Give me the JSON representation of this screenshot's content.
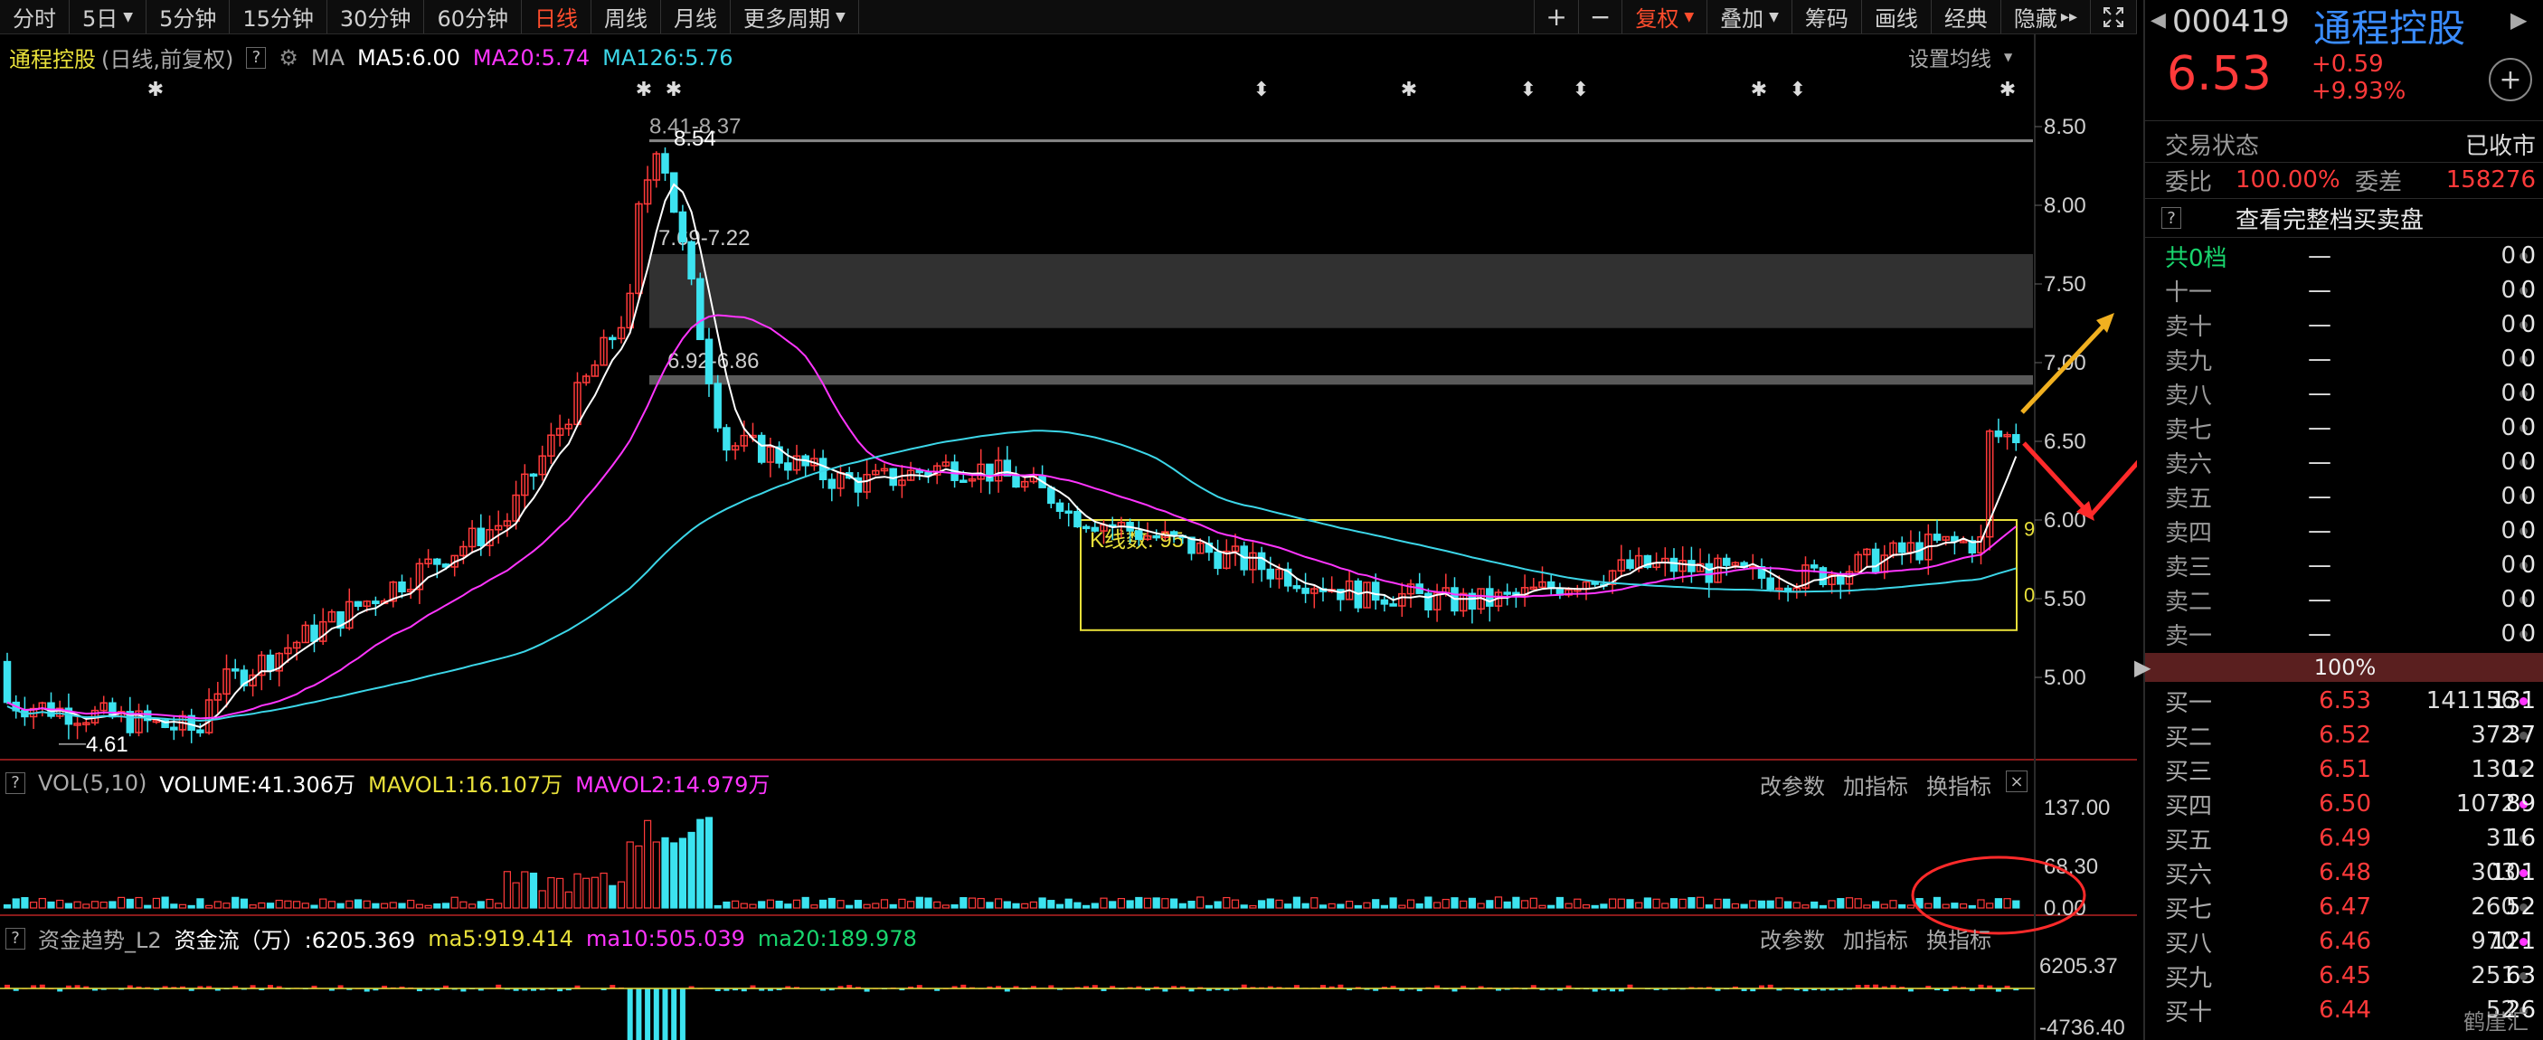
{
  "toolbar": {
    "periods": [
      {
        "label": "分时",
        "caret": false,
        "active": false
      },
      {
        "label": "5日",
        "caret": true,
        "active": false
      },
      {
        "label": "5分钟",
        "caret": false,
        "active": false
      },
      {
        "label": "15分钟",
        "caret": false,
        "active": false
      },
      {
        "label": "30分钟",
        "caret": false,
        "active": false
      },
      {
        "label": "60分钟",
        "caret": false,
        "active": false
      },
      {
        "label": "日线",
        "caret": false,
        "active": true
      },
      {
        "label": "周线",
        "caret": false,
        "active": false
      },
      {
        "label": "月线",
        "caret": false,
        "active": false
      },
      {
        "label": "更多周期",
        "caret": true,
        "active": false
      }
    ],
    "right_tools": [
      {
        "label": "+",
        "caret": false,
        "icon": "plus-icon"
      },
      {
        "label": "−",
        "caret": false,
        "icon": "minus-icon"
      },
      {
        "label": "复权",
        "caret": true,
        "active": true
      },
      {
        "label": "叠加",
        "caret": true
      },
      {
        "label": "筹码",
        "caret": false
      },
      {
        "label": "画线",
        "caret": false
      },
      {
        "label": "经典",
        "caret": false
      },
      {
        "label": "隐藏",
        "caret": false,
        "suffix": "▸▸"
      }
    ],
    "expand_icon": "expand-icon"
  },
  "kline_legend": {
    "name": "通程控股",
    "mode": "(日线,前复权)",
    "help": "?",
    "ma_label": "MA",
    "ma5": "MA5:6.00",
    "ma20": "MA20:5.74",
    "ma126": "MA126:5.76",
    "settings": "设置均线",
    "colors": {
      "ma5": "#ffffff",
      "ma20": "#ff35ff",
      "ma126": "#3cd6e8"
    }
  },
  "kline_annotations": {
    "high_label": "8.54",
    "high_range": "8.41-8.37",
    "gap1": "7.69-7.22",
    "gap2": "6.92-6.86",
    "low_label": "4.61",
    "box_label": "K线数: 95",
    "box_right_top": "9",
    "box_right_bottom": "0"
  },
  "price_axis": [
    "8.50",
    "8.00",
    "7.50",
    "7.00",
    "6.50",
    "6.00",
    "5.50",
    "5.00"
  ],
  "vol_legend": {
    "help": "?",
    "name": "VOL(5,10)",
    "volume": "VOLUME:41.306万",
    "mavol1": "MAVOL1:16.107万",
    "mavol2": "MAVOL2:14.979万",
    "tools": [
      "改参数",
      "加指标",
      "换指标"
    ],
    "close": "×"
  },
  "vol_axis": [
    "137.00",
    "68.30",
    "0.00"
  ],
  "flow_legend": {
    "help": "?",
    "name": "资金趋势_L2",
    "flow": "资金流（万）:6205.369",
    "ma5": "ma5:919.414",
    "ma10": "ma10:505.039",
    "ma20": "ma20:189.978",
    "tools": [
      "改参数",
      "加指标",
      "换指标"
    ]
  },
  "flow_axis": [
    "6205.37",
    "-4736.40"
  ],
  "stock": {
    "code": "000419",
    "name": "通程控股",
    "price": "6.53",
    "change": "+0.59",
    "change_pct": "+9.93%",
    "status_label": "交易状态",
    "status_value": "已收市",
    "ratio_label": "委比",
    "ratio_value": "100.00%",
    "diff_label": "委差",
    "diff_value": "158276",
    "full_book": "查看完整档买卖盘",
    "help": "?",
    "mid_label": "100%"
  },
  "sell_book": [
    {
      "label": "共0档",
      "price": "—",
      "vol": "0",
      "cnt": "0",
      "highlight": true
    },
    {
      "label": "十一",
      "price": "—",
      "vol": "0",
      "cnt": "0"
    },
    {
      "label": "卖十",
      "price": "—",
      "vol": "0",
      "cnt": "0"
    },
    {
      "label": "卖九",
      "price": "—",
      "vol": "0",
      "cnt": "0"
    },
    {
      "label": "卖八",
      "price": "—",
      "vol": "0",
      "cnt": "0"
    },
    {
      "label": "卖七",
      "price": "—",
      "vol": "0",
      "cnt": "0"
    },
    {
      "label": "卖六",
      "price": "—",
      "vol": "0",
      "cnt": "0"
    },
    {
      "label": "卖五",
      "price": "—",
      "vol": "0",
      "cnt": "0"
    },
    {
      "label": "卖四",
      "price": "—",
      "vol": "0",
      "cnt": "0"
    },
    {
      "label": "卖三",
      "price": "—",
      "vol": "0",
      "cnt": "0"
    },
    {
      "label": "卖二",
      "price": "—",
      "vol": "0",
      "cnt": "0"
    },
    {
      "label": "卖一",
      "price": "—",
      "vol": "0",
      "cnt": "0"
    }
  ],
  "buy_book": [
    {
      "label": "买一",
      "price": "6.53",
      "vol": "141156",
      "cnt": "131",
      "pink": true
    },
    {
      "label": "买二",
      "price": "6.52",
      "vol": "372",
      "cnt": "37"
    },
    {
      "label": "买三",
      "price": "6.51",
      "vol": "130",
      "cnt": "12"
    },
    {
      "label": "买四",
      "price": "6.50",
      "vol": "1072",
      "cnt": "89",
      "pink": true
    },
    {
      "label": "买五",
      "price": "6.49",
      "vol": "31",
      "cnt": "16"
    },
    {
      "label": "买六",
      "price": "6.48",
      "vol": "303",
      "cnt": "101",
      "pink": true
    },
    {
      "label": "买七",
      "price": "6.47",
      "vol": "260",
      "cnt": "52"
    },
    {
      "label": "买八",
      "price": "6.46",
      "vol": "970",
      "cnt": "121",
      "pink": true
    },
    {
      "label": "买九",
      "price": "6.45",
      "vol": "251",
      "cnt": "63"
    },
    {
      "label": "买十",
      "price": "6.44",
      "vol": "52",
      "cnt": "26"
    }
  ],
  "watermark": "鹤崖汇"
}
